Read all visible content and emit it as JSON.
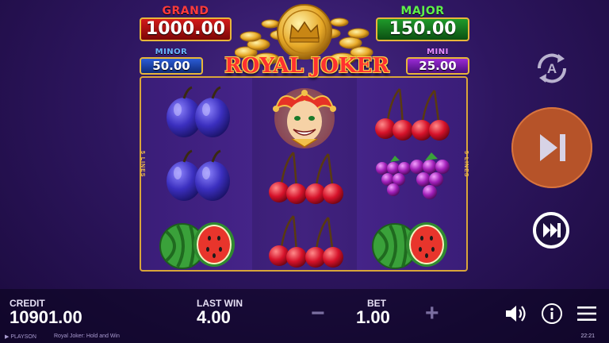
{
  "jackpots": {
    "grand": {
      "label": "GRAND",
      "value": "1000.00"
    },
    "major": {
      "label": "MAJOR",
      "value": "150.00"
    },
    "minor": {
      "label": "MINOR",
      "value": "50.00"
    },
    "mini": {
      "label": "MINI",
      "value": "25.00"
    }
  },
  "logo_text": "ROYAL JOKER",
  "lines_label": "5 LINES",
  "reels": [
    [
      "plum",
      "plum",
      "watermelon"
    ],
    [
      "joker",
      "cherry",
      "cherry"
    ],
    [
      "cherry",
      "grapes",
      "watermelon"
    ]
  ],
  "bottom": {
    "credit_label": "CREDIT",
    "credit_value": "10901.00",
    "last_win_label": "LAST WIN",
    "last_win_value": "4.00",
    "bet_label": "BET",
    "bet_value": "1.00",
    "bet_minus": "−",
    "bet_plus": "+"
  },
  "footer": {
    "brand": "▶ PLAYSON",
    "game_title": "Royal Joker: Hold and Win",
    "clock": "22:21"
  },
  "icons": {
    "autoplay": "autoplay-icon",
    "spin": "skip-forward-icon",
    "turbo": "fast-forward-icon",
    "sound": "speaker-icon",
    "info": "info-icon",
    "menu": "hamburger-menu-icon"
  },
  "colors": {
    "background": "#2e1660",
    "spin_button": "#b65329",
    "frame": "#d9a53a"
  }
}
